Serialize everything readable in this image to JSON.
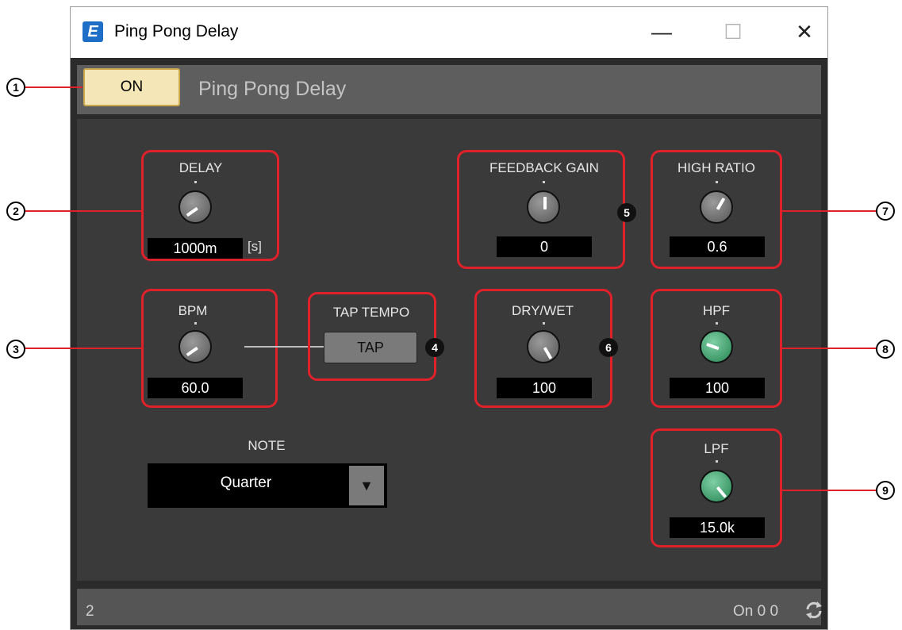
{
  "window": {
    "title": "Ping Pong Delay",
    "app_icon_letter": "E"
  },
  "window_controls": {
    "minimize": "—",
    "maximize": "☐",
    "close": "✕"
  },
  "header": {
    "on_label": "ON",
    "title": "Ping Pong Delay"
  },
  "delay": {
    "label": "DELAY",
    "value": "1000m",
    "unit": "[s]"
  },
  "bpm": {
    "label": "BPM",
    "value": "60.0"
  },
  "tap_tempo": {
    "label": "TAP TEMPO",
    "button": "TAP"
  },
  "note": {
    "label": "NOTE",
    "selected": "Quarter",
    "arrow": "▼"
  },
  "feedback_gain": {
    "label": "FEEDBACK GAIN",
    "value": "0"
  },
  "dry_wet": {
    "label": "DRY/WET",
    "value": "100"
  },
  "high_ratio": {
    "label": "HIGH RATIO",
    "value": "0.6"
  },
  "hpf": {
    "label": "HPF",
    "value": "100"
  },
  "lpf": {
    "label": "LPF",
    "value": "15.0k"
  },
  "status": {
    "left": "2",
    "right": "On 0 0"
  },
  "callouts": {
    "c1": "1",
    "c2": "2",
    "c3": "3",
    "c4": "4",
    "c5": "5",
    "c6": "6",
    "c7": "7",
    "c8": "8",
    "c9": "9"
  },
  "colors": {
    "highlight": "#e0202a",
    "on_button": "#f4e6b6",
    "green_knob": "#4fae7c",
    "panel": "#3a3a3a"
  }
}
